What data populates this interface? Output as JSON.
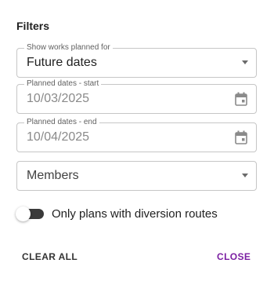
{
  "filters": {
    "title": "Filters",
    "works_planned": {
      "legend": "Show works planned for",
      "value": "Future dates"
    },
    "start_date": {
      "legend": "Planned dates - start",
      "value": "10/03/2025"
    },
    "end_date": {
      "legend": "Planned dates - end",
      "value": "10/04/2025"
    },
    "members": {
      "placeholder": "Members"
    },
    "diversion_toggle": {
      "label": "Only plans with diversion routes",
      "checked": false
    },
    "actions": {
      "clear_label": "CLEAR ALL",
      "close_label": "CLOSE"
    },
    "colors": {
      "accent": "#7b1fa2",
      "toggle_track": "#3a3a3a",
      "border": "#c6c6c6"
    },
    "icons": {
      "dropdown": "chevron-down-icon",
      "calendar": "calendar-icon"
    }
  }
}
